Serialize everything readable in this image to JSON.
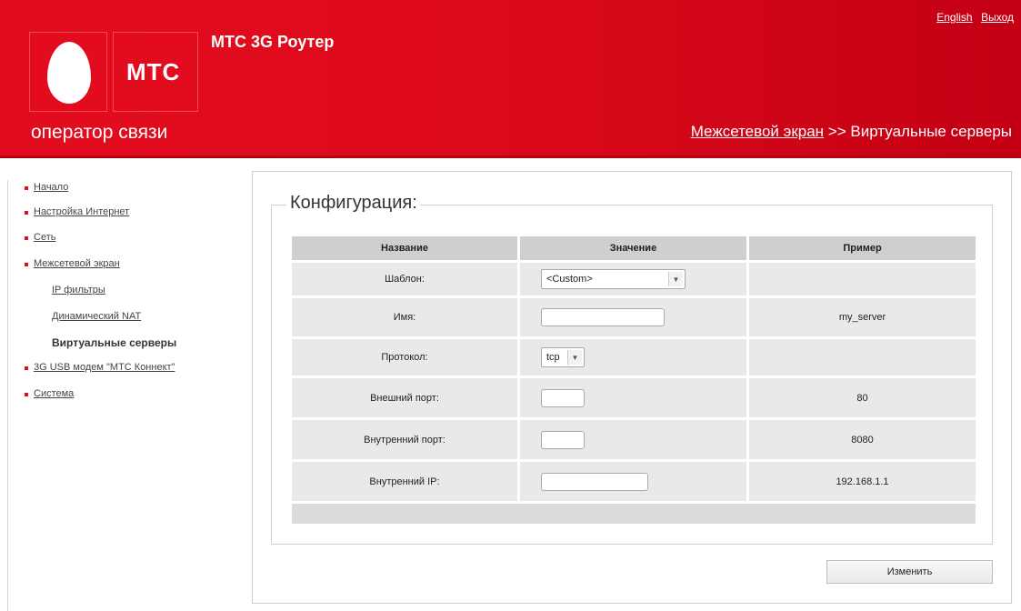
{
  "header": {
    "logo_text": "МТС",
    "tagline": "оператор связи",
    "app_title": "МТС 3G Роутер",
    "links": {
      "english": "English",
      "logout": "Выход"
    },
    "breadcrumb": {
      "parent": "Межсетевой экран",
      "separator": ">>",
      "current": "Виртуальные серверы"
    }
  },
  "sidebar": {
    "items": [
      {
        "label": "Начало"
      },
      {
        "label": "Настройка Интернет"
      },
      {
        "label": "Сеть"
      },
      {
        "label": "Межсетевой экран"
      },
      {
        "label": "3G USB модем \"МТС Коннект\""
      },
      {
        "label": "Система"
      }
    ],
    "subitems": [
      {
        "label": "IP фильтры"
      },
      {
        "label": "Динамический NAT"
      },
      {
        "label": "Виртуальные серверы",
        "active": true
      }
    ]
  },
  "config": {
    "legend": "Конфигурация:",
    "columns": [
      "Название",
      "Значение",
      "Пример"
    ],
    "rows": [
      {
        "name": "Шаблон:",
        "value": "<Custom>",
        "example": ""
      },
      {
        "name": "Имя:",
        "value": "",
        "example": "my_server"
      },
      {
        "name": "Протокол:",
        "value": "tcp",
        "example": ""
      },
      {
        "name": "Внешний порт:",
        "value": "",
        "example": "80"
      },
      {
        "name": "Внутренний порт:",
        "value": "",
        "example": "8080"
      },
      {
        "name": "Внутренний IP:",
        "value": "",
        "example": "192.168.1.1"
      }
    ],
    "submit_label": "Изменить"
  },
  "colors": {
    "brand_red": "#e30c1e",
    "header_cell": "#cfcfcf",
    "body_cell": "#e9e9e9"
  }
}
